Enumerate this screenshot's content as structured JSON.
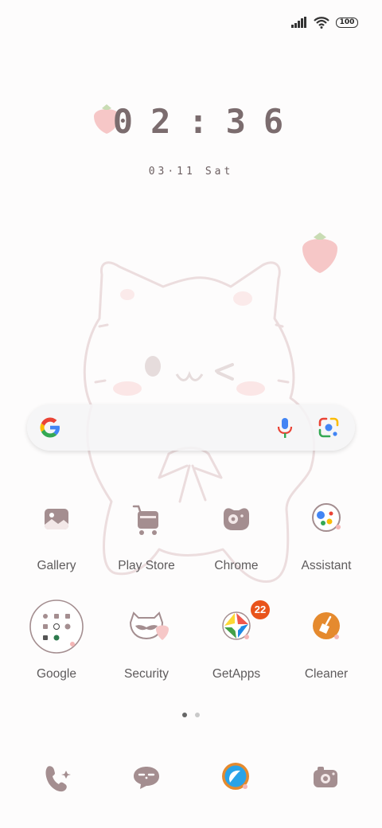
{
  "status_bar": {
    "battery": "100",
    "icons": [
      "signal-icon",
      "wifi-icon",
      "battery-icon"
    ]
  },
  "clock": {
    "time": "02:36",
    "date_month_day": "03·11",
    "weekday": "Sat"
  },
  "search": {
    "icons": [
      "google-g-icon",
      "mic-icon",
      "lens-icon"
    ]
  },
  "apps_row1": [
    {
      "label": "Gallery",
      "icon": "gallery-icon"
    },
    {
      "label": "Play Store",
      "icon": "play-store-icon"
    },
    {
      "label": "Chrome",
      "icon": "chrome-icon"
    },
    {
      "label": "Assistant",
      "icon": "assistant-icon"
    }
  ],
  "apps_row2": [
    {
      "label": "Google",
      "icon": "google-folder-icon"
    },
    {
      "label": "Security",
      "icon": "security-icon"
    },
    {
      "label": "GetApps",
      "icon": "getapps-icon",
      "badge": "22"
    },
    {
      "label": "Cleaner",
      "icon": "cleaner-icon"
    }
  ],
  "page_indicator": {
    "pages": 2,
    "current": 1
  },
  "dock": [
    {
      "icon": "phone-icon"
    },
    {
      "icon": "messages-icon"
    },
    {
      "icon": "browser-icon"
    },
    {
      "icon": "camera-icon"
    }
  ],
  "colors": {
    "icon_fill": "#a48e90",
    "strawberry": "#f4b6b6",
    "badge": "#e9541b",
    "background": "#fdfcfc"
  }
}
